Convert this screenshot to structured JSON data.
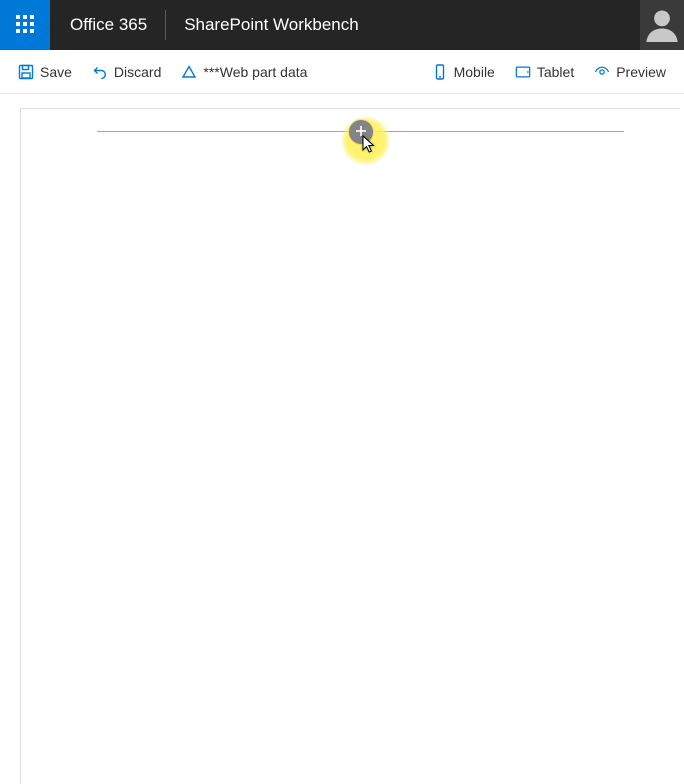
{
  "suite": {
    "brand": "Office 365",
    "app_name": "SharePoint Workbench"
  },
  "commands": {
    "save": "Save",
    "discard": "Discard",
    "webpart_data": "***Web part data",
    "mobile": "Mobile",
    "tablet": "Tablet",
    "preview": "Preview"
  },
  "canvas": {
    "add_button_title": "Add a new web part"
  }
}
